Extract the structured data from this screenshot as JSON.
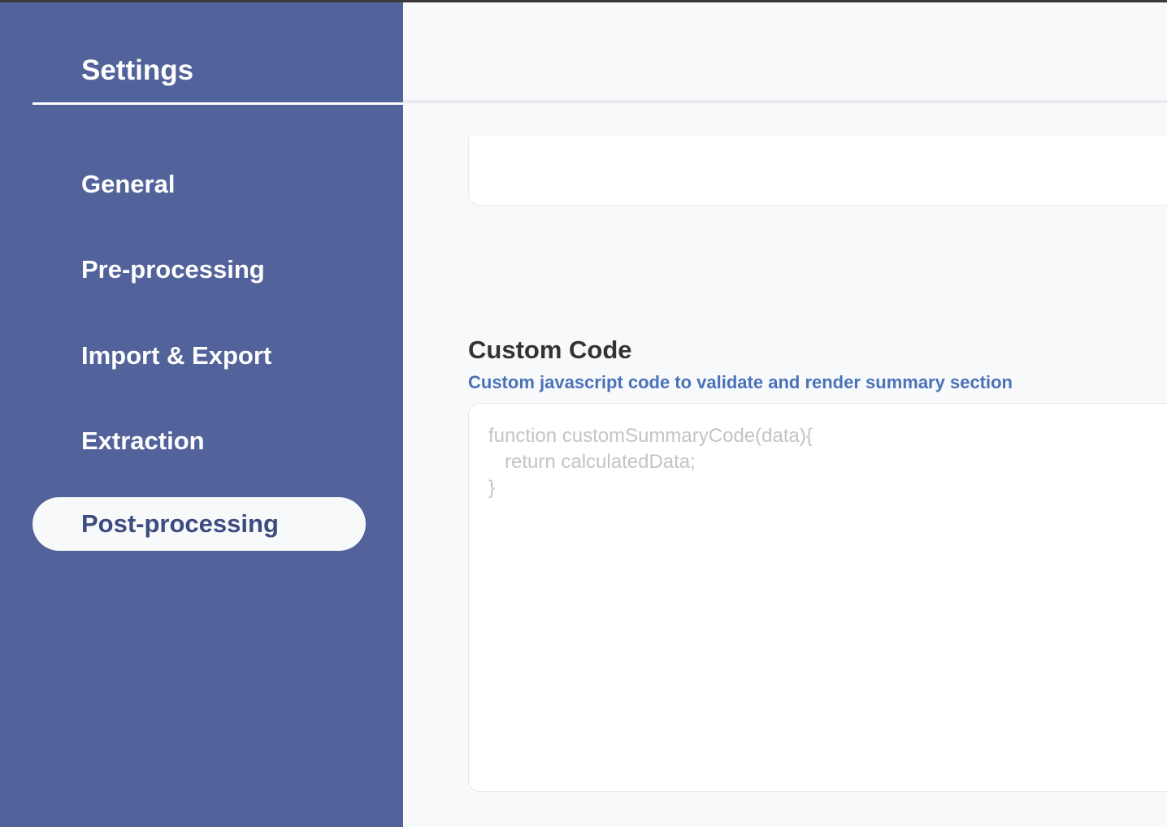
{
  "sidebar": {
    "title": "Settings",
    "items": [
      {
        "label": "General",
        "active": false
      },
      {
        "label": "Pre-processing",
        "active": false
      },
      {
        "label": "Import & Export",
        "active": false
      },
      {
        "label": "Extraction",
        "active": false
      },
      {
        "label": "Post-processing",
        "active": true
      }
    ]
  },
  "main": {
    "custom_code": {
      "title": "Custom Code",
      "description": "Custom javascript code to validate and render summary section",
      "placeholder": "function customSummaryCode(data){\n   return calculatedData;\n}"
    }
  },
  "colors": {
    "sidebar_bg": "#52629a",
    "active_text": "#3d4b80",
    "description": "#4a72b8",
    "content_bg": "#f8f9fb"
  }
}
